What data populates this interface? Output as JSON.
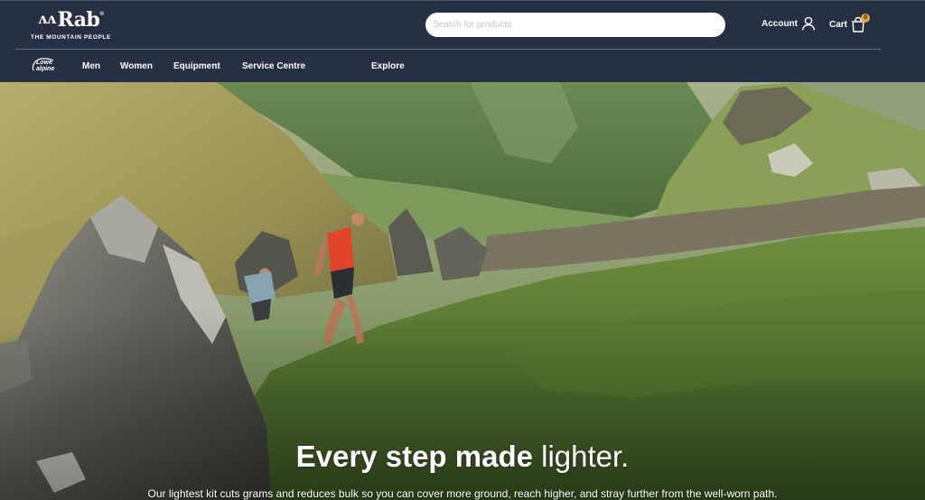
{
  "brand": {
    "name": "Rab",
    "tagline": "THE MOUNTAIN PEOPLE",
    "sub_brand": "Lowe alpine"
  },
  "search": {
    "placeholder": "Search for products",
    "value": ""
  },
  "header_actions": {
    "account_label": "Account",
    "cart_label": "Cart",
    "cart_count": "0"
  },
  "nav": {
    "items": [
      {
        "label": "Men"
      },
      {
        "label": "Women"
      },
      {
        "label": "Equipment"
      },
      {
        "label": "Service Centre"
      },
      {
        "label": "Explore"
      }
    ]
  },
  "hero": {
    "title_bold": "Every step made",
    "title_light": "lighter.",
    "subtitle": "Our lightest kit cuts grams and reduces bulk so you can cover more ground, reach higher, and stray further from the well-worn path."
  },
  "colors": {
    "header_bg": "#262f44",
    "cart_badge": "#e6a53a",
    "search_bg": "#ffffff"
  }
}
